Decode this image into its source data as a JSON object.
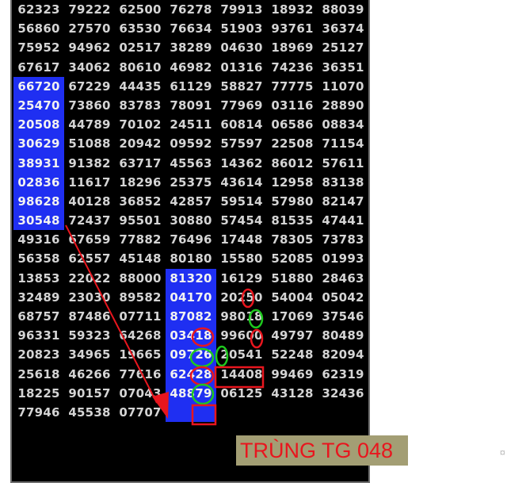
{
  "caption": "TRÙNG TG 048",
  "edge_glyph": "¤",
  "colors": {
    "background": "#000000",
    "cell_text": "#d4d4d4",
    "highlight": "#1f2ff2",
    "mark_red": "#e8161e",
    "mark_green": "#1ec81e",
    "caption_bg": "#a39e74"
  },
  "rows": [
    [
      "62323",
      "79222",
      "62500",
      "76278",
      "79913",
      "18932",
      "88039"
    ],
    [
      "56860",
      "27570",
      "63530",
      "76634",
      "51903",
      "93761",
      "36374"
    ],
    [
      "75952",
      "94962",
      "02517",
      "38289",
      "04630",
      "18969",
      "25127"
    ],
    [
      "67617",
      "34062",
      "80610",
      "46982",
      "01316",
      "74236",
      "36351"
    ],
    [
      "66720",
      "67229",
      "44435",
      "61129",
      "58827",
      "77775",
      "11070"
    ],
    [
      "25470",
      "73860",
      "83783",
      "78091",
      "77969",
      "03116",
      "28890"
    ],
    [
      "20508",
      "44789",
      "70102",
      "24511",
      "60814",
      "06586",
      "08834"
    ],
    [
      "30629",
      "51088",
      "20942",
      "09592",
      "57597",
      "22508",
      "71154"
    ],
    [
      "38931",
      "91382",
      "63717",
      "45563",
      "14362",
      "86012",
      "57611"
    ],
    [
      "02836",
      "11617",
      "18296",
      "25375",
      "43614",
      "12958",
      "83138"
    ],
    [
      "98628",
      "40128",
      "36852",
      "42857",
      "59514",
      "57980",
      "82147"
    ],
    [
      "30548",
      "72437",
      "95501",
      "30880",
      "57454",
      "81535",
      "47441"
    ],
    [
      "49316",
      "67659",
      "77882",
      "76496",
      "17448",
      "78305",
      "73783"
    ],
    [
      "56358",
      "62557",
      "45148",
      "80180",
      "15580",
      "52085",
      "01993"
    ],
    [
      "13853",
      "22022",
      "88000",
      "81320",
      "16129",
      "51880",
      "28463"
    ],
    [
      "32489",
      "23030",
      "89582",
      "04170",
      "20250",
      "54004",
      "05042"
    ],
    [
      "68757",
      "87486",
      "07711",
      "87082",
      "98018",
      "17069",
      "37546"
    ],
    [
      "96331",
      "59323",
      "64268",
      "03418",
      "99600",
      "49797",
      "80489"
    ],
    [
      "20823",
      "34965",
      "19665",
      "09726",
      "20541",
      "52248",
      "82094"
    ],
    [
      "25618",
      "46266",
      "77616",
      "62428",
      "14408",
      "99469",
      "62319"
    ],
    [
      "18225",
      "90157",
      "07043",
      "48879",
      "06125",
      "43128",
      "32436"
    ],
    [
      "77946",
      "45538",
      "07707",
      "",
      "",
      "",
      ""
    ]
  ],
  "highlights": [
    [
      4,
      0
    ],
    [
      5,
      0
    ],
    [
      6,
      0
    ],
    [
      7,
      0
    ],
    [
      8,
      0
    ],
    [
      9,
      0
    ],
    [
      10,
      0
    ],
    [
      11,
      0
    ],
    [
      14,
      3
    ],
    [
      15,
      3
    ],
    [
      16,
      3
    ],
    [
      17,
      3
    ],
    [
      18,
      3
    ],
    [
      19,
      3
    ],
    [
      20,
      3
    ],
    [
      21,
      3
    ]
  ]
}
